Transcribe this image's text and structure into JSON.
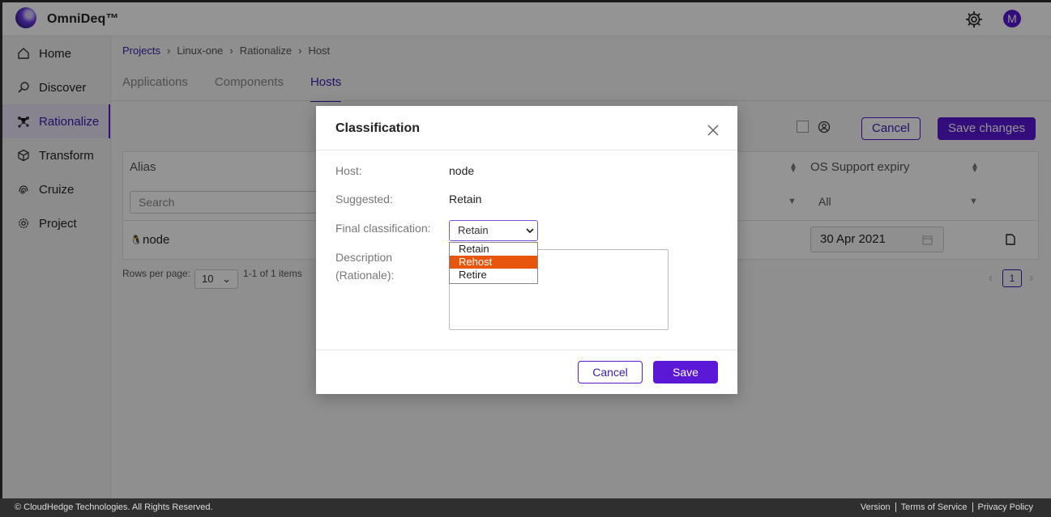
{
  "app": {
    "brand": "OmniDeq™",
    "avatar_initial": "M"
  },
  "sidebar": {
    "items": [
      {
        "label": "Home",
        "icon": "home-icon"
      },
      {
        "label": "Discover",
        "icon": "search-icon"
      },
      {
        "label": "Rationalize",
        "icon": "rationalize-icon",
        "active": true
      },
      {
        "label": "Transform",
        "icon": "cube-icon"
      },
      {
        "label": "Cruize",
        "icon": "fingerprint-icon"
      },
      {
        "label": "Project",
        "icon": "gear-icon"
      }
    ]
  },
  "breadcrumb": [
    "Projects",
    "Linux-one",
    "Rationalize",
    "Host"
  ],
  "tabs": [
    "Applications",
    "Components",
    "Hosts"
  ],
  "toolbar": {
    "cancel_label": "Cancel",
    "save_label": "Save changes"
  },
  "table": {
    "col_alias": "Alias",
    "col_os_support": "OS Support expiry",
    "search_placeholder": "Search",
    "os_filter": "All",
    "row_alias": "node",
    "row_date": "30 Apr 2021"
  },
  "pager": {
    "rows_per_page_label": "Rows per page:",
    "rows_value": "10",
    "range": "1-1 of 1 items",
    "page": "1"
  },
  "modal": {
    "title": "Classification",
    "host_label": "Host:",
    "host_value": "node",
    "suggested_label": "Suggested:",
    "suggested_value": "Retain",
    "final_label": "Final classification:",
    "final_value": "Retain",
    "options": [
      "Retain",
      "Rehost",
      "Retire"
    ],
    "highlighted_option": "Rehost",
    "desc_label_1": "Description",
    "desc_label_2": "(Rationale):",
    "cancel_label": "Cancel",
    "save_label": "Save"
  },
  "footer": {
    "copyright": "© CloudHedge Technologies. All Rights Reserved.",
    "links": [
      "Version",
      "Terms of Service",
      "Privacy Policy"
    ]
  },
  "colors": {
    "accent": "#5b18d6",
    "highlight": "#e8550c"
  }
}
